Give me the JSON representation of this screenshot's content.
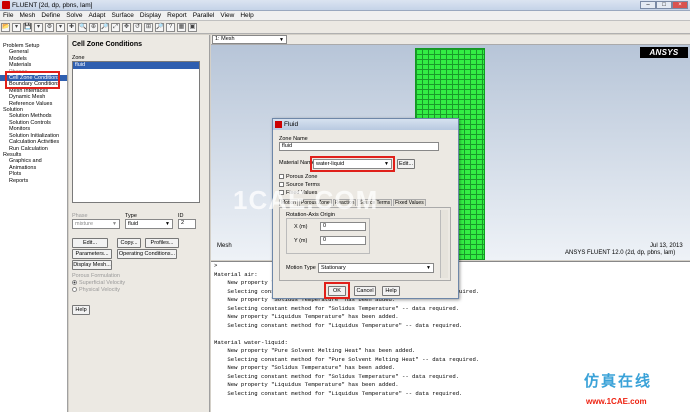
{
  "window": {
    "title": "FLUENT  [2d, dp, pbns, lam]",
    "min": "–",
    "max": "□",
    "close": "×"
  },
  "menu": [
    "File",
    "Mesh",
    "Define",
    "Solve",
    "Adapt",
    "Surface",
    "Display",
    "Report",
    "Parallel",
    "View",
    "Help"
  ],
  "toolbar": [
    "📂",
    "▾",
    "💾",
    "▾",
    "⚙",
    "▾",
    "✚",
    "🔍",
    "⊕",
    "🔎",
    "⤢",
    "✥",
    "↺",
    "⊞",
    "🔎",
    "?",
    "▦",
    "▣"
  ],
  "nav": {
    "sections": [
      {
        "title": "Problem Setup",
        "items": [
          {
            "label": "General"
          },
          {
            "label": "Models"
          },
          {
            "label": "Materials"
          },
          {
            "label": "Phases",
            "dim": true
          },
          {
            "label": "Cell Zone Conditions",
            "selected": true
          },
          {
            "label": "Boundary Conditions"
          },
          {
            "label": "Mesh Interfaces"
          },
          {
            "label": "Dynamic Mesh"
          },
          {
            "label": "Reference Values"
          }
        ]
      },
      {
        "title": "Solution",
        "items": [
          {
            "label": "Solution Methods"
          },
          {
            "label": "Solution Controls"
          },
          {
            "label": "Monitors"
          },
          {
            "label": "Solution Initialization"
          },
          {
            "label": "Calculation Activities"
          },
          {
            "label": "Run Calculation"
          }
        ]
      },
      {
        "title": "Results",
        "items": [
          {
            "label": "Graphics and Animations"
          },
          {
            "label": "Plots"
          },
          {
            "label": "Reports"
          }
        ]
      }
    ]
  },
  "panel": {
    "title": "Cell Zone Conditions",
    "zone_label": "Zone",
    "zone_items": [
      "fluid"
    ],
    "phase_label": "Phase",
    "phase_value": "mixture",
    "type_label": "Type",
    "type_value": "fluid",
    "id_label": "ID",
    "id_value": "2",
    "edit": "Edit...",
    "copy": "Copy...",
    "profiles": "Profiles...",
    "parameters": "Parameters...",
    "opcond": "Operating Conditions...",
    "display_mesh": "Display Mesh...",
    "porous_label": "Porous Formulation",
    "superficial": "Superficial Velocity",
    "physical": "Physical Velocity",
    "help": "Help"
  },
  "graphics": {
    "tab": "1: Mesh",
    "logo": "ANSYS",
    "caption": "Mesh",
    "date": "Jul 13, 2013",
    "version": "ANSYS FLUENT 12.0 (2d, dp, pbns, lam)"
  },
  "console_lines": [
    ">",
    "Material air:",
    "    New property \"Pure Solvent Melting Heat\" has been added.",
    "    Selecting constant method for \"Pure Solvent Melting Heat\" -- data required.",
    "    New property \"Solidus Temperature\" has been added.",
    "    Selecting constant method for \"Solidus Temperature\" -- data required.",
    "    New property \"Liquidus Temperature\" has been added.",
    "    Selecting constant method for \"Liquidus Temperature\" -- data required.",
    "",
    "Material water-liquid:",
    "    New property \"Pure Solvent Melting Heat\" has been added.",
    "    Selecting constant method for \"Pure Solvent Melting Heat\" -- data required.",
    "    New property \"Solidus Temperature\" has been added.",
    "    Selecting constant method for \"Solidus Temperature\" -- data required.",
    "    New property \"Liquidus Temperature\" has been added.",
    "    Selecting constant method for \"Liquidus Temperature\" -- data required."
  ],
  "dialog": {
    "title": "Fluid",
    "zone_name_label": "Zone Name",
    "zone_name": "fluid",
    "material_label": "Material Name",
    "material": "water-liquid",
    "edit": "Edit...",
    "checks": [
      "Porous Zone",
      "Source Terms",
      "Fixed Values"
    ],
    "tabs": [
      "Motion",
      "Porous Zone",
      "Reaction",
      "Source Terms",
      "Fixed Values"
    ],
    "axis_label": "Rotation-Axis Origin",
    "x_label": "X (m)",
    "x_value": "0",
    "y_label": "Y (m)",
    "y_value": "0",
    "motion_label": "Motion Type",
    "motion_value": "Stationary",
    "ok": "OK",
    "cancel": "Cancel",
    "help": "Help"
  },
  "watermark": "1CAE.COM",
  "cn_watermark": "仿真在线",
  "cn_url": "www.1CAE.com"
}
